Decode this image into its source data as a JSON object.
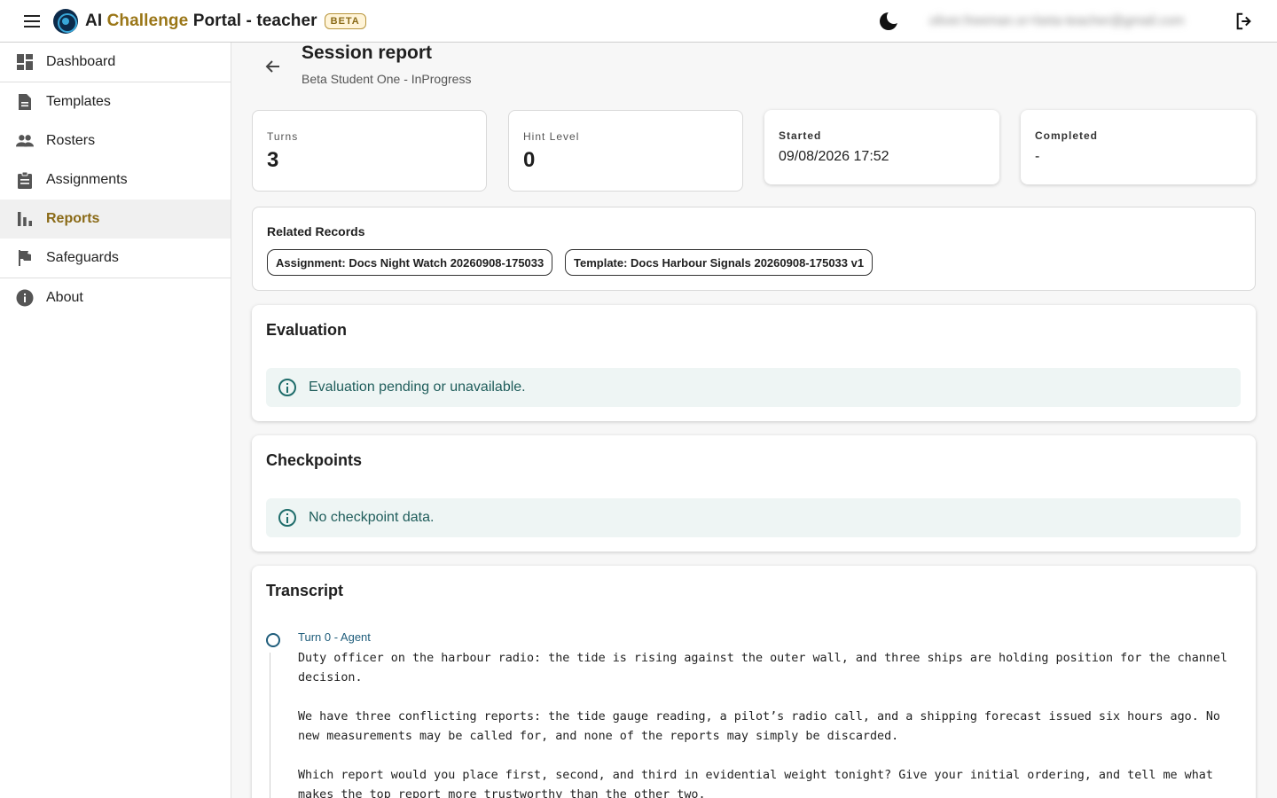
{
  "header": {
    "title_prefix": "AI",
    "title_accent": "Challenge",
    "title_suffix": "Portal - teacher",
    "beta_badge": "BETA",
    "user_email": "oliver.freeman.sr+beta-teacher@gmail.com"
  },
  "sidebar": {
    "items": [
      {
        "label": "Dashboard",
        "icon": "dashboard-icon"
      },
      {
        "label": "Templates",
        "icon": "document-icon"
      },
      {
        "label": "Rosters",
        "icon": "people-icon"
      },
      {
        "label": "Assignments",
        "icon": "clipboard-icon"
      },
      {
        "label": "Reports",
        "icon": "bar-chart-icon",
        "active": true
      },
      {
        "label": "Safeguards",
        "icon": "flag-icon"
      },
      {
        "label": "About",
        "icon": "info-icon"
      }
    ]
  },
  "page": {
    "title": "Session report",
    "subtitle": "Beta Student One - InProgress"
  },
  "stats": {
    "turns_label": "Turns",
    "turns_value": "3",
    "hint_label": "Hint Level",
    "hint_value": "0",
    "started_label": "Started",
    "started_value": "09/08/2026 17:52",
    "completed_label": "Completed",
    "completed_value": "-"
  },
  "related": {
    "title": "Related Records",
    "assignment_chip": "Assignment: Docs Night Watch 20260908-175033",
    "template_chip": "Template: Docs Harbour Signals 20260908-175033 v1"
  },
  "evaluation": {
    "title": "Evaluation",
    "message": "Evaluation pending or unavailable."
  },
  "checkpoints": {
    "title": "Checkpoints",
    "message": "No checkpoint data."
  },
  "transcript": {
    "title": "Transcript",
    "turns": [
      {
        "label": "Turn 0 - Agent",
        "text": "Duty officer on the harbour radio: the tide is rising against the outer wall, and three ships are holding position for the channel decision.\n\nWe have three conflicting reports: the tide gauge reading, a pilot’s radio call, and a shipping forecast issued six hours ago. No new measurements may be called for, and none of the reports may simply be discarded.\n\nWhich report would you place first, second, and third in evidential weight tonight? Give your initial ordering, and tell me what makes the top report more trustworthy than the other two."
      }
    ]
  },
  "colors": {
    "accent": "#9a7617",
    "info_bg": "#eef5f4",
    "info_text": "#1f5d5b"
  }
}
